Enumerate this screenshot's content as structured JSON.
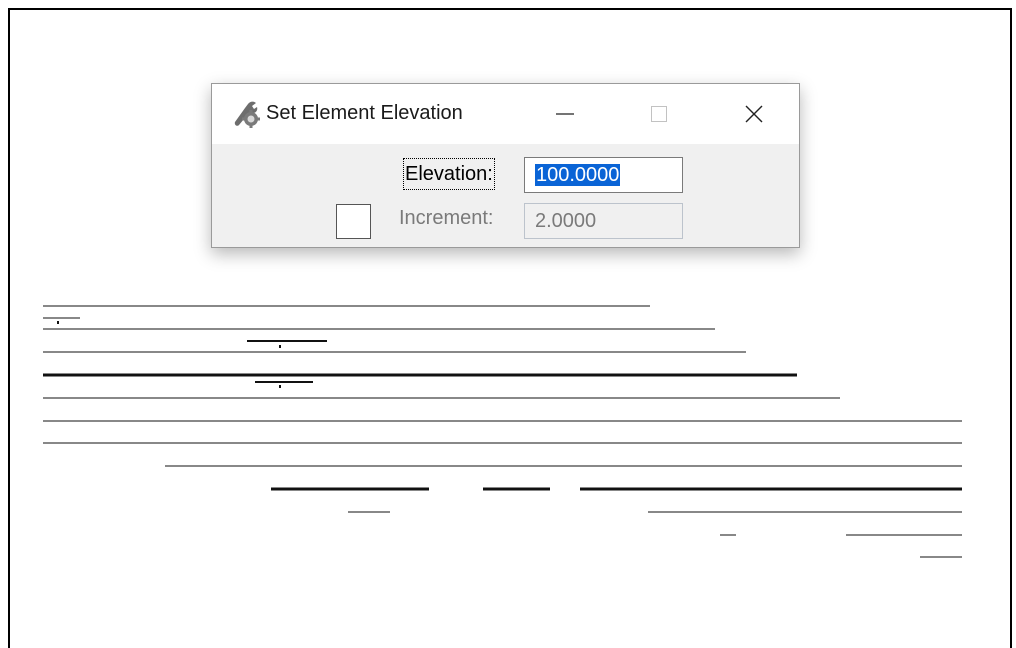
{
  "dialog": {
    "title": "Set Element Elevation",
    "title_icon": "key-wrench-icon",
    "elevation_label": "Elevation:",
    "elevation_value": "100.0000",
    "increment_label": "Increment:",
    "increment_value": "2.0000",
    "increment_enabled": false,
    "increment_checked": false
  },
  "window_buttons": {
    "minimize_icon": "minimize-icon",
    "maximize_icon": "maximize-icon",
    "close_icon": "close-icon"
  },
  "colors": {
    "selection_highlight": "#0a64d6",
    "dialog_body": "#f0f0f0",
    "disabled_text": "#7a7a7a"
  }
}
